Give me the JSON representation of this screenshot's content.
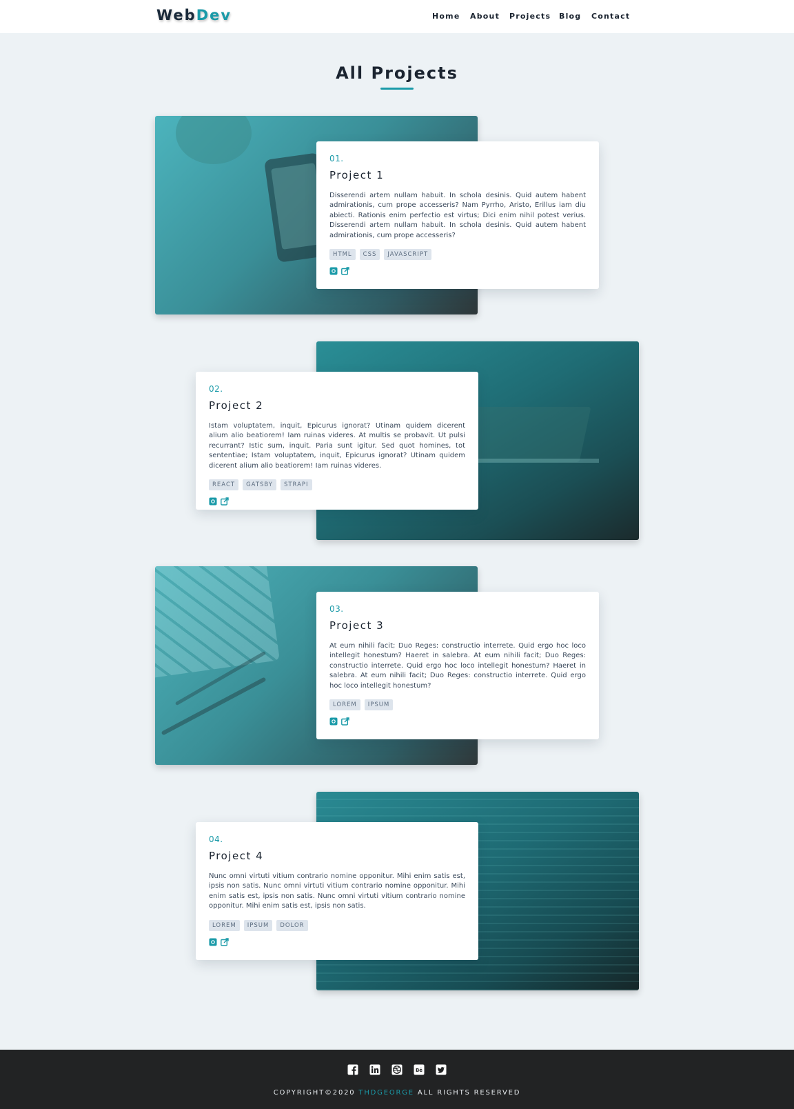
{
  "header": {
    "logo_main": "Web",
    "logo_accent": "Dev",
    "nav": [
      "Home",
      "About",
      "Projects",
      "Blog",
      "Contact"
    ]
  },
  "main": {
    "title": "All Projects",
    "projects": [
      {
        "number": "01.",
        "title": "Project 1",
        "description": "Disserendi artem nullam habuit. In schola desinis. Quid autem habent admirationis, cum prope accesseris? Nam Pyrrho, Aristo, Erillus iam diu abiecti. Rationis enim perfectio est virtus; Dici enim nihil potest verius. Disserendi artem nullam habuit. In schola desinis. Quid autem habent admirationis, cum prope accesseris?",
        "tags": [
          "HTML",
          "CSS",
          "JAVASCRIPT"
        ]
      },
      {
        "number": "02.",
        "title": "Project 2",
        "description": "Istam voluptatem, inquit, Epicurus ignorat? Utinam quidem dicerent alium alio beatiorem! Iam ruinas videres. At multis se probavit. Ut pulsi recurrant? Istic sum, inquit. Paria sunt igitur. Sed quot homines, tot sententiae; Istam voluptatem, inquit, Epicurus ignorat? Utinam quidem dicerent alium alio beatiorem! Iam ruinas videres.",
        "tags": [
          "REACT",
          "GATSBY",
          "STRAPI"
        ]
      },
      {
        "number": "03.",
        "title": "Project 3",
        "description": "At eum nihili facit; Duo Reges: constructio interrete. Quid ergo hoc loco intellegit honestum? Haeret in salebra. At eum nihili facit; Duo Reges: constructio interrete. Quid ergo hoc loco intellegit honestum? Haeret in salebra. At eum nihili facit; Duo Reges: constructio interrete. Quid ergo hoc loco intellegit honestum?",
        "tags": [
          "LOREM",
          "IPSUM"
        ]
      },
      {
        "number": "04.",
        "title": "Project 4",
        "description": "Nunc omni virtuti vitium contrario nomine opponitur. Mihi enim satis est, ipsis non satis. Nunc omni virtuti vitium contrario nomine opponitur. Mihi enim satis est, ipsis non satis. Nunc omni virtuti vitium contrario nomine opponitur. Mihi enim satis est, ipsis non satis.",
        "tags": [
          "LOREM",
          "IPSUM",
          "DOLOR"
        ]
      }
    ],
    "project_icons": [
      "github-icon",
      "external-link-icon"
    ]
  },
  "footer": {
    "socials": [
      "facebook-icon",
      "linkedin-icon",
      "dribbble-icon",
      "behance-icon",
      "twitter-icon"
    ],
    "copyright_prefix": "COPYRIGHT©2020 ",
    "copyright_author": "THDGEORGE",
    "copyright_suffix": " ALL RIGHTS RESERVED"
  },
  "colors": {
    "accent": "#1a9aa8",
    "background": "#edf2f5",
    "footer": "#222324",
    "text": "#1b2430"
  }
}
